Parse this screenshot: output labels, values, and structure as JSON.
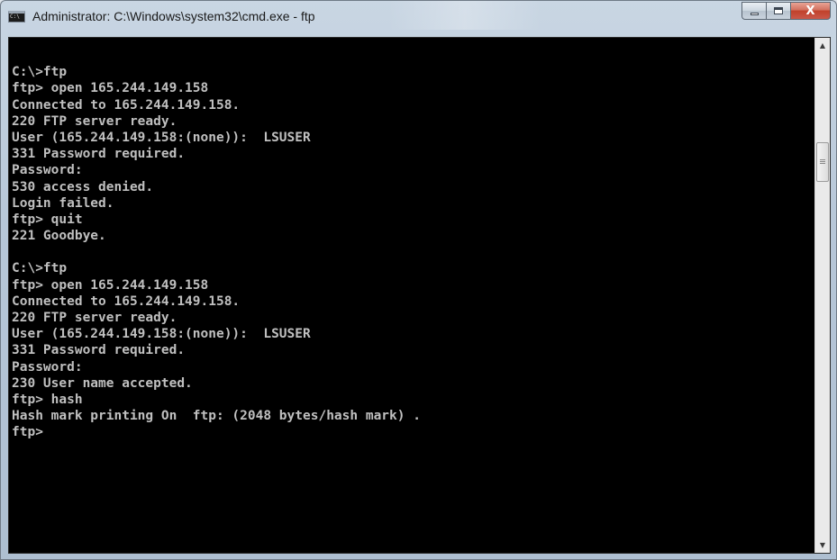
{
  "window": {
    "title": "Administrator: C:\\Windows\\system32\\cmd.exe - ftp",
    "icon": "cmd-console-icon",
    "icon_text": "C:\\",
    "buttons": {
      "minimize_icon": "minimize-icon",
      "maximize_icon": "maximize-icon",
      "close_icon": "close-icon",
      "close_glyph": "X"
    }
  },
  "console": {
    "background": "#000000",
    "foreground": "#c0c0c0",
    "lines": [
      "",
      "C:\\>ftp",
      "ftp> open 165.244.149.158",
      "Connected to 165.244.149.158.",
      "220 FTP server ready.",
      "User (165.244.149.158:(none)):  LSUSER",
      "331 Password required.",
      "Password:",
      "530 access denied.",
      "Login failed.",
      "ftp> quit",
      "221 Goodbye.",
      "",
      "C:\\>ftp",
      "ftp> open 165.244.149.158",
      "Connected to 165.244.149.158.",
      "220 FTP server ready.",
      "User (165.244.149.158:(none)):  LSUSER",
      "331 Password required.",
      "Password:",
      "230 User name accepted.",
      "ftp> hash",
      "Hash mark printing On  ftp: (2048 bytes/hash mark) .",
      "ftp>"
    ]
  },
  "scrollbar": {
    "up_arrow": "▲",
    "down_arrow": "▼",
    "position_fraction": 0.2
  }
}
